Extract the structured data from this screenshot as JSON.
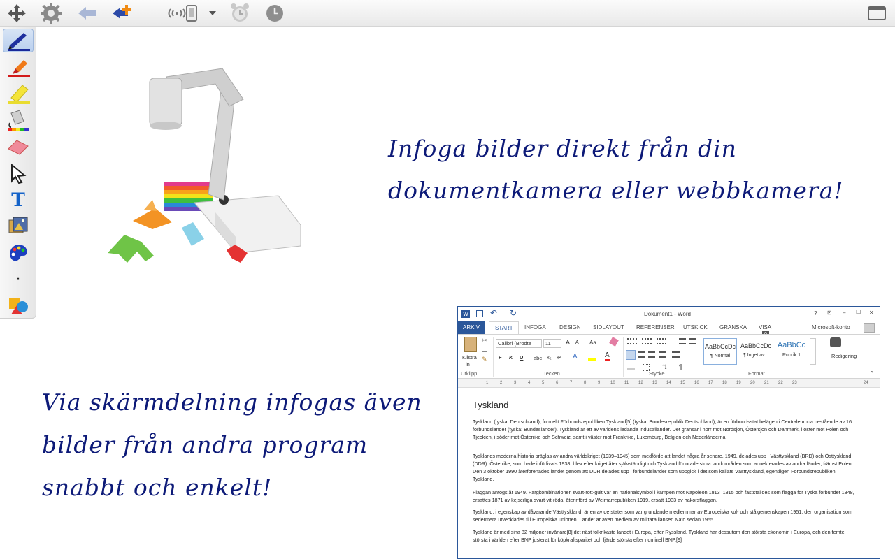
{
  "toolbar": {
    "icons": [
      "move-icon",
      "settings-gear-icon",
      "back-arrow-icon",
      "add-page-icon",
      "wireless-device-icon",
      "dropdown-caret-icon",
      "alarm-clock-icon",
      "clock-icon",
      "window-icon"
    ]
  },
  "palette": {
    "tools": [
      "pen-tool",
      "marker-tool",
      "highlighter-tool",
      "fill-tool",
      "eraser-tool",
      "select-arrow-tool",
      "text-tool",
      "image-tool",
      "color-palette-tool",
      "dot-tool",
      "shapes-tool"
    ],
    "text_tool_glyph": "T",
    "dot_glyph": "·"
  },
  "captions": {
    "top_line1": "Infoga bilder direkt från din",
    "top_line2": "dokumentkamera eller webbkamera!",
    "bottom_line1": "Via skärmdelning infogas även",
    "bottom_line2": "bilder från andra program",
    "bottom_line3": "snabbt och enkelt!"
  },
  "word": {
    "title": "Dokument1 - Word",
    "title_buttons": [
      "?",
      "⊡",
      "–",
      "☐",
      "✕"
    ],
    "tabs": [
      "ARKIV",
      "START",
      "INFOGA",
      "DESIGN",
      "SIDLAYOUT",
      "REFERENSER",
      "UTSKICK",
      "GRANSKA",
      "VISA"
    ],
    "account": "Microsoft-konto",
    "badge": "0",
    "ribbon": {
      "paste_label": "Klistra",
      "paste_label2": "in",
      "font_name": "Calibri (Brödte",
      "font_size": "11",
      "grow_label": "A",
      "shrink_label": "A",
      "case_label": "Aa",
      "bold": "F",
      "italic": "K",
      "underline": "U",
      "strike": "abc",
      "sub": "x₂",
      "sup": "x²",
      "styles": [
        {
          "preview": "AaBbCcDc",
          "name": "¶ Normal"
        },
        {
          "preview": "AaBbCcDc",
          "name": "¶ Inget av..."
        },
        {
          "preview": "AaBbCc",
          "name": "Rubrik 1"
        }
      ],
      "edit_label": "Redigering",
      "groups": [
        "Urklipp",
        "Tecken",
        "Stycke",
        "Format"
      ]
    },
    "ruler_numbers": [
      "1",
      "2",
      "3",
      "4",
      "5",
      "6",
      "7",
      "8",
      "9",
      "10",
      "11",
      "12",
      "13",
      "14",
      "15",
      "16",
      "17",
      "18",
      "19",
      "20",
      "21",
      "22",
      "23",
      "24"
    ],
    "doc": {
      "heading": "Tyskland",
      "paragraphs": [
        "Tyskland (tyska: Deutschland), formellt Förbundsrepubliken Tyskland[5] (tyska: Bundesrepublik Deutschland), är en förbundsstat belägen i Centraleuropa bestående av 16 förbundsländer (tyska: Bundesländer). Tyskland är ett av världens ledande industriländer. Det gränsar i norr mot Nordsjön, Östersjön och Danmark, i öster mot Polen och Tjeckien, i söder mot Österrike och Schweiz, samt i väster mot Frankrike, Luxemburg, Belgien och Nederländerna.",
        "Tysklands moderna historia präglas av andra världskriget (1939–1945) som medförde att landet några år senare, 1949, delades upp i Västtyskland (BRD) och Östtyskland (DDR). Österrike, som hade införlivats 1938, blev efter kriget åter självständigt och Tyskland förlorade stora landområden som annekterades av andra länder, främst Polen. Den 3 oktober 1990 återförenades landet genom att DDR delades upp i förbundsländer som uppgick i det som kallats Västtyskland, egentligen Förbundsrepubliken Tyskland.",
        "Flaggan antogs år 1949. Färgkombinationen svart-rött-gult var en nationalsymbol i kampen mot Napoleon 1813–1815 och fastställdes som flagga för Tyska förbundet 1848, ersattes 1871 av kejserliga svart-vit-röda, återinförd av Weimarrepubliken 1919, ersatt 1933 av hakorsflaggan.",
        "Tyskland, i egenskap av dåvarande Västtyskland, är en av de stater som var grundande medlemmar av Europeiska kol- och stålgemenskapen 1951, den organisation som sedermera utvecklades till Europeiska unionen. Landet är även medlem av militäralliansen Nato sedan 1955.",
        "Tyskland är med sina 82 miljoner invånare[8] det näst folkrikaste landet i Europa, efter Ryssland. Tyskland har dessutom den största ekonomin i Europa, och den femte största i världen efter BNP justerat för köpkraftsparitet och fjärde största efter nominell BNP.[9]"
      ]
    },
    "colors": {
      "accent": "#2b579a"
    }
  }
}
